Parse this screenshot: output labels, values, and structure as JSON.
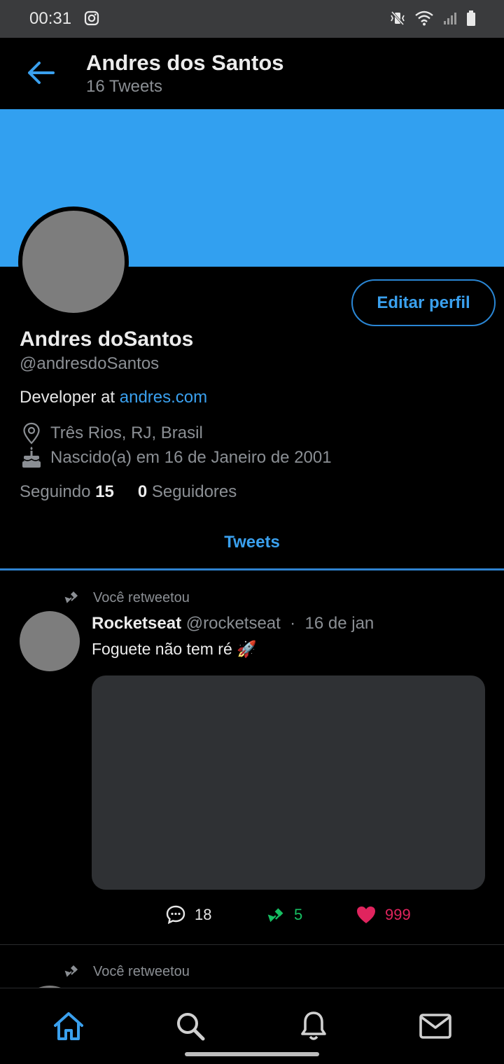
{
  "status_bar": {
    "time": "00:31"
  },
  "header": {
    "title": "Andres dos Santos",
    "subtitle": "16 Tweets"
  },
  "profile": {
    "edit_label": "Editar perfil",
    "name": "Andres doSantos",
    "handle": "@andresdoSantos",
    "bio_text": "Developer at ",
    "bio_link": "andres.com",
    "location": "Três Rios, RJ, Brasil",
    "birth": "Nascido(a) em 16 de Janeiro de 2001",
    "following_label": "Seguindo",
    "following_count": "15",
    "followers_count": "0",
    "followers_label": "Seguidores"
  },
  "tabs": {
    "tweets_label": "Tweets"
  },
  "feed": {
    "tweets": [
      {
        "retweet_label": "Você retweetou",
        "author": "Rocketseat",
        "handle": "@rocketseat",
        "separator": "·",
        "date": "16 de jan",
        "text": "Foguete não tem ré 🚀",
        "replies": "18",
        "retweets": "5",
        "likes": "999"
      },
      {
        "retweet_label": "Você retweetou"
      }
    ]
  },
  "colors": {
    "accent": "#3aa0ee",
    "cover": "#32a0f0",
    "retweet_green": "#17bf63",
    "like_red": "#e0245e"
  }
}
